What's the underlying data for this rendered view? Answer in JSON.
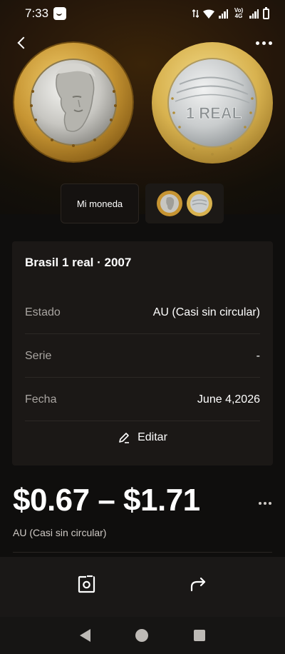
{
  "status_bar": {
    "time": "7:33",
    "network_label": "Vo) 4G"
  },
  "header": {
    "back_icon": "chevron-left-icon",
    "more_icon": "more-horizontal-icon"
  },
  "images": {
    "front_coin": "effigy-of-republic",
    "back_coin": "1 REAL",
    "thumb_label": "Mi moneda"
  },
  "card": {
    "title": "Brasil 1 real · 2007",
    "rows": [
      {
        "label": "Estado",
        "value": "AU (Casi sin circular)"
      },
      {
        "label": "Serie",
        "value": "-"
      },
      {
        "label": "Fecha",
        "value": "June 4,2026"
      }
    ],
    "edit_label": "Editar"
  },
  "price": {
    "range": "$0.67 – $1.71",
    "grade": "AU (Casi sin circular)"
  },
  "colors": {
    "background_top": "#3a2409",
    "background": "#0f0e0d",
    "card": "#1b1816",
    "coin_gold": "#d8b24f",
    "coin_silver": "#c9cccd"
  }
}
